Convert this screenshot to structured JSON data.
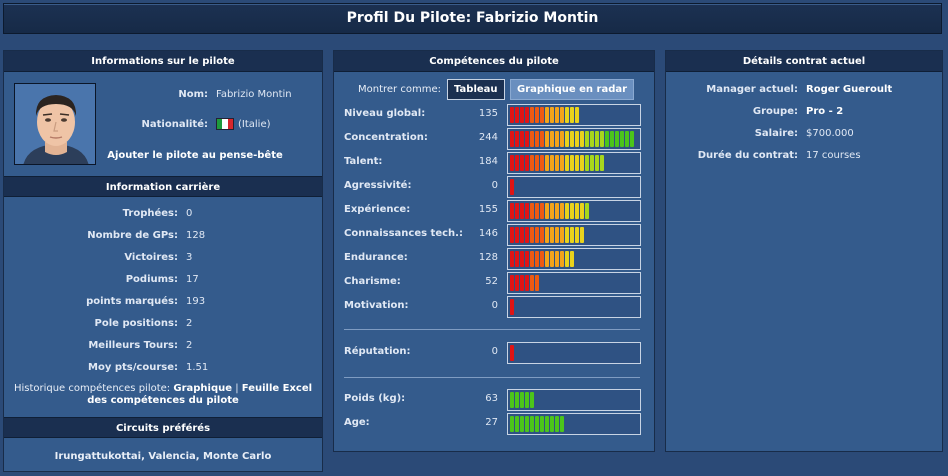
{
  "title": "Profil Du Pilote: Fabrizio Montin",
  "driver_panel": {
    "header": "Informations sur le pilote",
    "name_label": "Nom:",
    "name_value": "Fabrizio Montin",
    "nationality_label": "Nationalité:",
    "nationality_value": "(Italie)",
    "flag_colors": [
      "#1e9a3c",
      "#ffffff",
      "#d7262c"
    ],
    "watchlist_link": "Ajouter le pilote au pense-bête"
  },
  "career": {
    "header": "Information carrière",
    "rows": [
      {
        "label": "Trophées:",
        "value": "0"
      },
      {
        "label": "Nombre de GPs:",
        "value": "128"
      },
      {
        "label": "Victoires:",
        "value": "3"
      },
      {
        "label": "Podiums:",
        "value": "17"
      },
      {
        "label": "points marqués:",
        "value": "193"
      },
      {
        "label": "Pole positions:",
        "value": "2"
      },
      {
        "label": "Meilleurs Tours:",
        "value": "2"
      },
      {
        "label": "Moy pts/course:",
        "value": "1.51"
      }
    ],
    "history_prefix": "Historique compétences pilote:",
    "history_link_graph": "Graphique",
    "history_sep": "|",
    "history_link_excel": "Feuille Excel des compétences du pilote"
  },
  "circuits": {
    "header": "Circuits préférés",
    "list": [
      "Irungattukottai",
      "Valencia",
      "Monte Carlo"
    ]
  },
  "skills_panel": {
    "header": "Compétences du pilote",
    "show_as_label": "Montrer comme:",
    "btn_table": "Tableau",
    "btn_radar": "Graphique en radar",
    "skills": [
      {
        "label": "Niveau global:",
        "value": 135,
        "segments": 14
      },
      {
        "label": "Concentration:",
        "value": 244,
        "segments": 25
      },
      {
        "label": "Talent:",
        "value": 184,
        "segments": 19
      },
      {
        "label": "Agressivité:",
        "value": 0,
        "segments": 1
      },
      {
        "label": "Expérience:",
        "value": 155,
        "segments": 16
      },
      {
        "label": "Connaissances tech.:",
        "value": 146,
        "segments": 15
      },
      {
        "label": "Endurance:",
        "value": 128,
        "segments": 13
      },
      {
        "label": "Charisme:",
        "value": 52,
        "segments": 6
      },
      {
        "label": "Motivation:",
        "value": 0,
        "segments": 1
      }
    ],
    "reputation": {
      "label": "Réputation:",
      "value": 0,
      "segments": 1
    },
    "physical": [
      {
        "label": "Poids (kg):",
        "value": 63,
        "segments": 5
      },
      {
        "label": "Age:",
        "value": 27,
        "segments": 11
      }
    ],
    "physical_color": "#4cc51a"
  },
  "contract_panel": {
    "header": "Détails contrat actuel",
    "rows": [
      {
        "label": "Manager actuel:",
        "value": "Roger Gueroult",
        "bold": true
      },
      {
        "label": "Groupe:",
        "value": "Pro - 2",
        "bold": true
      },
      {
        "label": "Salaire:",
        "value": "$700.000",
        "bold": false
      },
      {
        "label": "Durée du contrat:",
        "value": "17 courses",
        "bold": false
      }
    ]
  }
}
